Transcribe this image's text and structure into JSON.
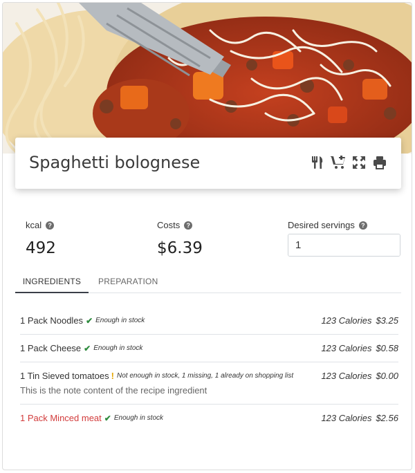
{
  "recipe": {
    "title": "Spaghetti bolognese",
    "actions": [
      {
        "icon": "utensils-icon"
      },
      {
        "icon": "cart-plus-icon"
      },
      {
        "icon": "expand-icon"
      },
      {
        "icon": "print-icon"
      }
    ]
  },
  "stats": {
    "kcal_label": "kcal",
    "kcal_value": "492",
    "costs_label": "Costs",
    "costs_value": "$6.39",
    "servings_label": "Desired servings",
    "servings_value": "1"
  },
  "tabs": {
    "ingredients": "INGREDIENTS",
    "preparation": "PREPARATION"
  },
  "ingredients": [
    {
      "name": "1 Pack Noodles",
      "status": "ok",
      "stock": "Enough in stock",
      "calories": "123 Calories",
      "price": "$3.25",
      "note": ""
    },
    {
      "name": "1 Pack Cheese",
      "status": "ok",
      "stock": "Enough in stock",
      "calories": "123 Calories",
      "price": "$0.58",
      "note": ""
    },
    {
      "name": "1 Tin Sieved tomatoes",
      "status": "warn",
      "stock": "Not enough in stock, 1 missing, 1 already on shopping list",
      "calories": "123 Calories",
      "price": "$0.00",
      "note": "This is the note content of the recipe ingredient"
    },
    {
      "name": "1 Pack Minced meat",
      "status": "ok",
      "stock": "Enough in stock",
      "calories": "123 Calories",
      "price": "$2.56",
      "note": ""
    }
  ],
  "colors": {
    "accent_dark": "#3a3f48",
    "ok_green": "#2e8b3e",
    "warn_yellow": "#e6a700",
    "missing_red": "#d23b3b"
  }
}
